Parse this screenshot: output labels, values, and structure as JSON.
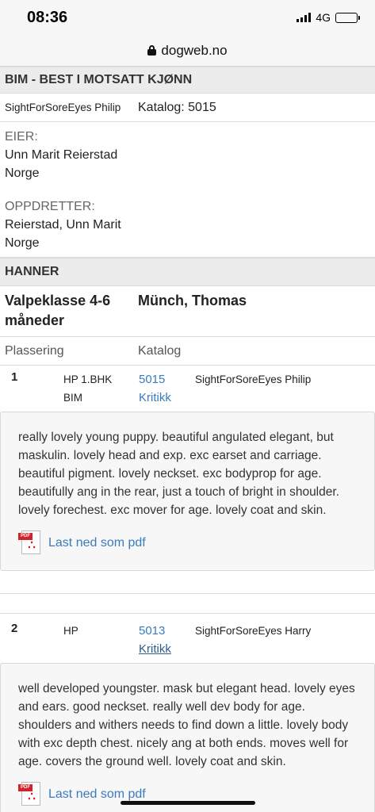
{
  "status_bar": {
    "time": "08:36",
    "network": "4G"
  },
  "browser": {
    "url": "dogweb.no"
  },
  "bim_section": {
    "title": "BIM - BEST I MOTSATT KJØNN",
    "dog_name": "SightForSoreEyes Philip",
    "catalog": "Katalog: 5015",
    "owner_label": "EIER:",
    "owner_name": "Unn Marit Reierstad",
    "owner_country": "Norge",
    "breeder_label": "OPPDRETTER:",
    "breeder_name": "Reierstad, Unn Marit",
    "breeder_country": "Norge"
  },
  "hanner_section": {
    "title": "HANNER",
    "class_name": "Valpeklasse 4-6 måneder",
    "judge": "Münch, Thomas",
    "col_placement": "Plassering",
    "col_catalog": "Katalog"
  },
  "results": [
    {
      "place": "1",
      "award_line1": "HP 1.BHK",
      "award_line2": "BIM",
      "catalog_number": "5015",
      "critique_link": "Kritikk",
      "dog_name": "SightForSoreEyes Philip",
      "critique": "really lovely young puppy. beautiful angulated elegant, but maskulin. lovely head and exp. exc earset and carriage. beautiful pigment. lovely neckset. exc bodyprop for age. beautifully ang in the rear, just a touch of bright in shoulder. lovely forechest. exc mover for age. lovely coat and skin.",
      "pdf_label": "Last ned som pdf"
    },
    {
      "place": "2",
      "award_line1": "HP",
      "award_line2": "",
      "catalog_number": "5013",
      "critique_link": "Kritikk",
      "dog_name": "SightForSoreEyes Harry",
      "critique": "well developed youngster. mask but elegant head. lovely eyes and ears. good neckset. really well dev body for age. shoulders and withers needs to find down a little. lovely body with exc depth chest. nicely ang at both ends. moves well for age. covers the ground well. lovely coat and skin.",
      "pdf_label": "Last ned som pdf"
    }
  ],
  "icons": {
    "pdf_icon_text": "PDF",
    "pdf_color": "#d2232a",
    "link_color": "#3a7bbd"
  }
}
